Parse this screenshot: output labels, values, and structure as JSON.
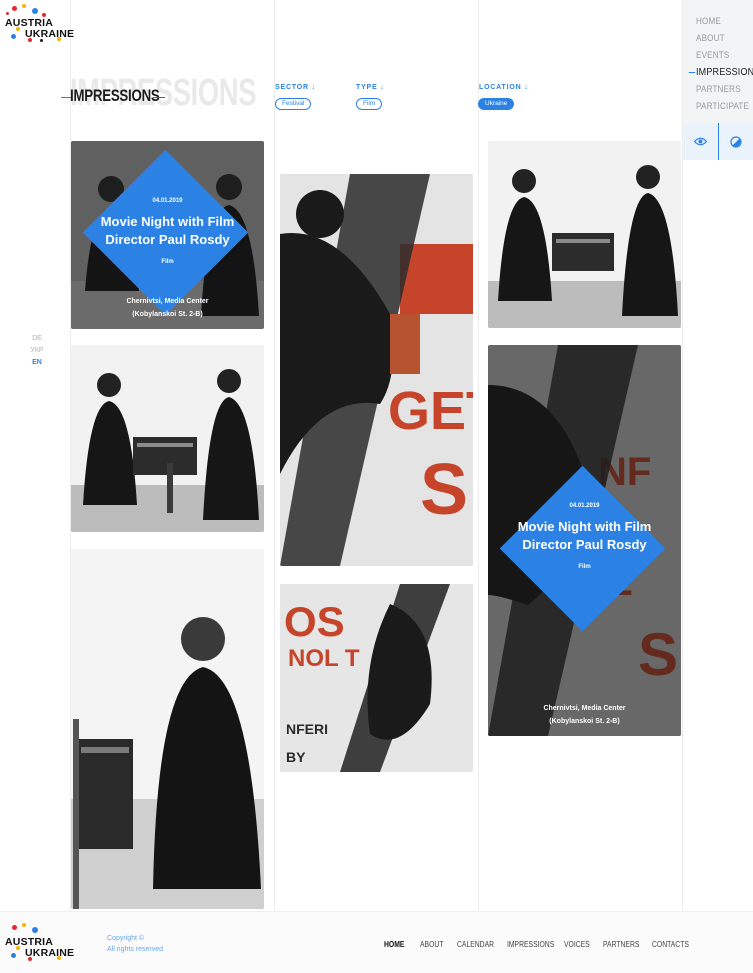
{
  "brand": {
    "line1": "AUSTRIA",
    "line2": "UKRAINE",
    "dot_colors": [
      "#e6262c",
      "#f4b400",
      "#2b82e4",
      "#1b1b1b"
    ]
  },
  "nav": {
    "items": [
      "HOME",
      "ABOUT",
      "EVENTS",
      "IMPRESSIONS",
      "PARTNERS",
      "PARTICIPATE"
    ],
    "active": "IMPRESSIONS",
    "tools": [
      "eye-icon",
      "contrast-icon"
    ]
  },
  "languages": {
    "items": [
      "DE",
      "УКР",
      "EN"
    ],
    "active": "EN"
  },
  "page": {
    "ghost_title": "IMPRESSIONS",
    "title": "IMPRESSIONS",
    "accent": "#2b82e4",
    "red": "#e6262c"
  },
  "filters": [
    {
      "label": "SECTOR",
      "arrow": "↓",
      "value": "Festival",
      "selected": false
    },
    {
      "label": "TYPE",
      "arrow": "↓",
      "value": "Film",
      "selected": false
    },
    {
      "label": "LOCATION",
      "arrow": "↓",
      "value": "Ukraine",
      "selected": true
    }
  ],
  "cards": [
    {
      "date": "04.01.2019",
      "title_line1": "Movie Night with Film",
      "title_line2": "Director Paul Rosdy",
      "tag": "Film",
      "place_line1": "Chernivtsi, Media Center",
      "place_line2": "(Kobylanskoi St. 2-B)"
    },
    {
      "date": "04.01.2019",
      "title_line1": "Movie Night with Film",
      "title_line2": "Director Paul Rosdy",
      "tag": "Film",
      "place_line1": "Chernivtsi, Media Center",
      "place_line2": "(Kobylanskoi St. 2-B)"
    }
  ],
  "footer": {
    "copyright_line1": "Copyright ©",
    "copyright_line2": "All rights reserved",
    "links": [
      "HOME",
      "ABOUT",
      "CALENDAR",
      "IMPRESSIONS",
      "VOICES",
      "PARTNERS",
      "CONTACTS"
    ],
    "active": "HOME"
  }
}
